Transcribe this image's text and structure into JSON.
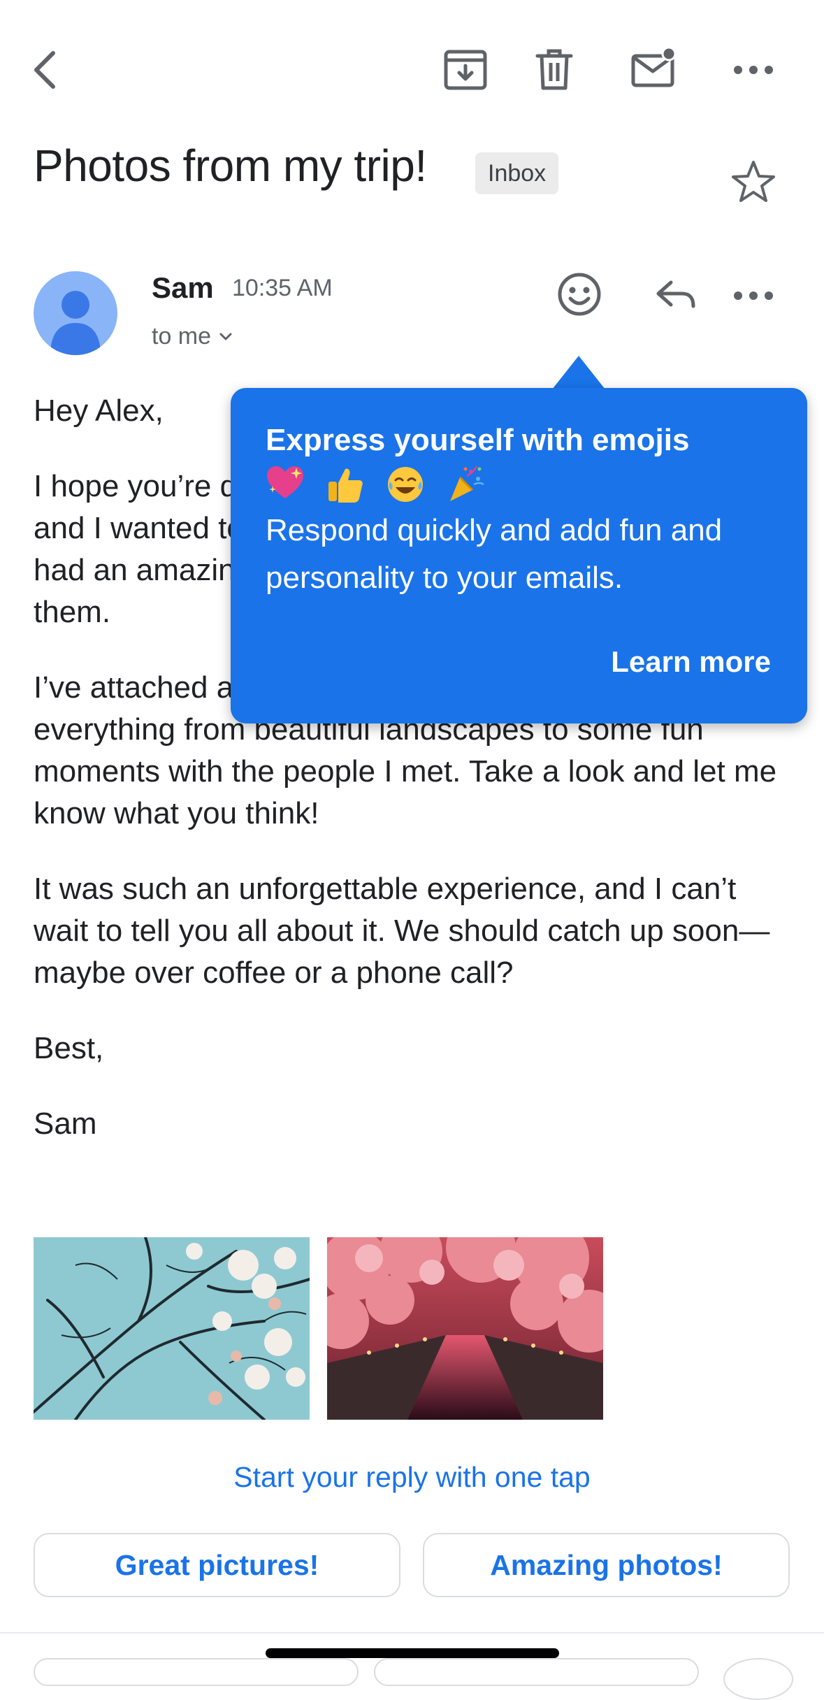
{
  "toolbar": {
    "back_icon": "chevron-left-icon",
    "archive_icon": "archive-icon",
    "delete_icon": "trash-icon",
    "mark_unread_icon": "mail-unread-icon",
    "more_icon": "more-horizontal-icon"
  },
  "email": {
    "subject": "Photos from my trip!",
    "label": "Inbox",
    "star_icon": "star-outline-icon",
    "sender": "Sam",
    "time": "10:35 AM",
    "recipient": "to me",
    "paragraphs": [
      "Hey Alex,",
      "I hope you’re doing well! I just got back from my trip, and I wanted to share some of the photos with you. I had an amazing time, and I think you’ll enjoy seeing them.",
      "I’ve attached a few of my favorite shots from the trip—everything from beautiful landscapes to some fun moments with the people I met. Take a look and let me know what you think!",
      "It was such an unforgettable experience, and I can’t wait to tell you all about it. We should catch up soon—maybe over coffee or a phone call?",
      "Best,",
      "Sam"
    ],
    "attachments": [
      {
        "name": "cherry-blossom-branches-photo"
      },
      {
        "name": "cherry-blossom-canal-night-photo"
      }
    ]
  },
  "tooltip": {
    "title": "Express yourself with emojis",
    "emojis": [
      "sparkling-heart",
      "thumbs-up",
      "tears-of-joy",
      "party-popper"
    ],
    "description": "Respond quickly and add fun and personality to your emails.",
    "link": "Learn more"
  },
  "smart_reply": {
    "hint": "Start your reply with one tap",
    "options": [
      "Great pictures!",
      "Amazing photos!"
    ]
  },
  "colors": {
    "accent": "#1a73e8",
    "tooltip_bg": "#1a73e8",
    "avatar_bg": "#8ab4f8",
    "avatar_fg": "#3b78e7"
  }
}
